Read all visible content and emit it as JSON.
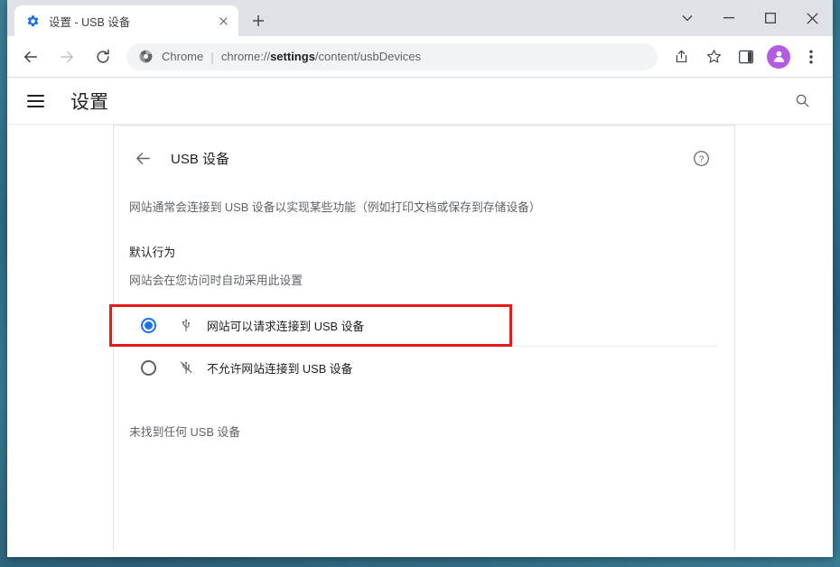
{
  "window": {
    "controls": {
      "tab_search": "tab-search-chevron",
      "minimize": "minimize",
      "maximize": "maximize",
      "close": "close"
    }
  },
  "tabstrip": {
    "tabs": [
      {
        "title": "设置 - USB 设备",
        "favicon": "settings-gear-icon",
        "close_label": "✕"
      }
    ],
    "new_tab_label": "+"
  },
  "toolbar": {
    "back_label": "←",
    "forward_label": "→",
    "reload_label": "⟳",
    "omnibox": {
      "icon": "chrome-logo-icon",
      "scheme_text": "Chrome",
      "separator": "|",
      "url_prefix": "chrome://",
      "url_bold": "settings",
      "url_suffix": "/content/usbDevices",
      "full_url": "chrome://settings/content/usbDevices"
    },
    "share_label": "share-icon",
    "bookmark_label": "star-icon",
    "sidepanel_label": "side-panel-icon",
    "avatar_label": "profile-avatar",
    "menu_label": "⋮"
  },
  "settings_header": {
    "menu_label": "hamburger-menu",
    "title": "设置",
    "search_label": "search-icon"
  },
  "page": {
    "back_label": "←",
    "title": "USB 设备",
    "help_label": "?",
    "description": "网站通常会连接到 USB 设备以实现某些功能（例如打印文档或保存到存储设备）",
    "default_behavior_label": "默认行为",
    "default_behavior_sub": "网站会在您访问时自动采用此设置",
    "options": [
      {
        "label": "网站可以请求连接到 USB 设备",
        "icon": "usb-icon",
        "selected": true,
        "highlighted": true
      },
      {
        "label": "不允许网站连接到 USB 设备",
        "icon": "usb-off-icon",
        "selected": false,
        "highlighted": false
      }
    ],
    "empty_state": "未找到任何 USB 设备"
  },
  "colors": {
    "accent": "#1a73e8",
    "highlight": "#e01b1b",
    "avatar": "#b45ce0",
    "text_primary": "#202124",
    "text_secondary": "#5f6368",
    "tabstrip_bg": "#dee1e6",
    "desktop": "#35798f"
  }
}
